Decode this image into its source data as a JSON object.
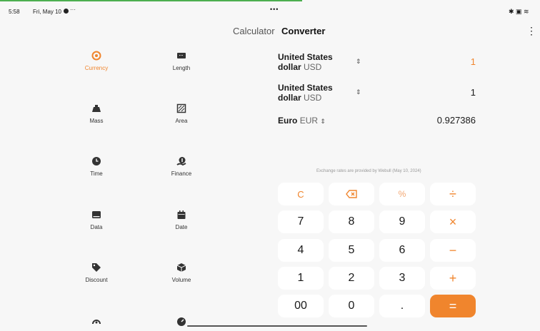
{
  "status": {
    "time": "5:58",
    "date": "Fri, May 10",
    "more": "···",
    "center": "•••",
    "right_icons": "✱ ▣ ≋"
  },
  "tabs": {
    "calculator": "Calculator",
    "converter": "Converter"
  },
  "menu_icon": "⋮",
  "categories": [
    {
      "label": "Currency",
      "icon": "currency-icon"
    },
    {
      "label": "Length",
      "icon": "ruler-icon"
    },
    {
      "label": "Mass",
      "icon": "weight-icon"
    },
    {
      "label": "Area",
      "icon": "area-icon"
    },
    {
      "label": "Time",
      "icon": "clock-icon"
    },
    {
      "label": "Finance",
      "icon": "finance-icon"
    },
    {
      "label": "Data",
      "icon": "data-icon"
    },
    {
      "label": "Date",
      "icon": "calendar-icon"
    },
    {
      "label": "Discount",
      "icon": "tag-icon"
    },
    {
      "label": "Volume",
      "icon": "cube-icon"
    }
  ],
  "conversions": [
    {
      "name_line1": "United States",
      "name_line2": "dollar",
      "code": "USD",
      "value": "1"
    },
    {
      "name_line1": "United States",
      "name_line2": "dollar",
      "code": "USD",
      "value": "1"
    },
    {
      "name_line1": "Euro",
      "code": "EUR",
      "value": "0.927386"
    }
  ],
  "rates_note": "Exchange rates are provided by Webull (May 10, 2024)",
  "keypad": {
    "clear": "C",
    "backspace": "⌫",
    "percent": "%",
    "divide": "÷",
    "k7": "7",
    "k8": "8",
    "k9": "9",
    "multiply": "×",
    "k4": "4",
    "k5": "5",
    "k6": "6",
    "minus": "−",
    "k1": "1",
    "k2": "2",
    "k3": "3",
    "plus": "+",
    "k00": "00",
    "k0": "0",
    "dot": ".",
    "equals": "="
  },
  "colors": {
    "accent": "#f0852d",
    "background": "#f7f7f7",
    "key": "#ffffff",
    "progress": "#4caf50"
  }
}
